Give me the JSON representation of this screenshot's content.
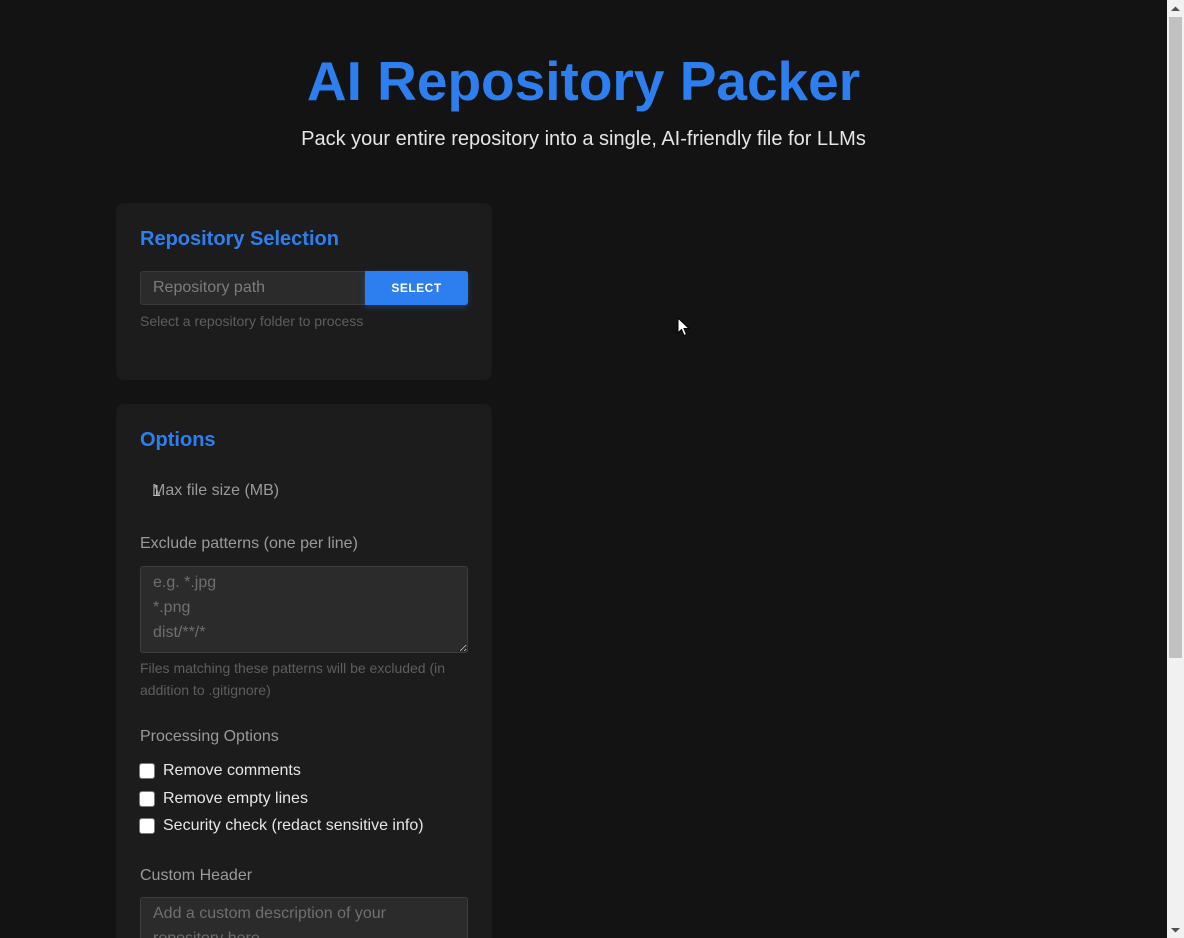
{
  "header": {
    "title": "AI Repository Packer",
    "subtitle": "Pack your entire repository into a single, AI-friendly file for LLMs"
  },
  "repository": {
    "title": "Repository Selection",
    "path_placeholder": "Repository path",
    "path_value": "",
    "select_label": "SELECT",
    "helper": "Select a repository folder to process"
  },
  "options": {
    "title": "Options",
    "max_size_value": "1",
    "max_size_label": "Max file size (MB)",
    "exclude_label": "Exclude patterns (one per line)",
    "exclude_placeholder": "e.g. *.jpg\n*.png\ndist/**/*",
    "exclude_helper": "Files matching these patterns will be excluded (in addition to .gitignore)",
    "processing_label": "Processing Options",
    "checkboxes": [
      {
        "label": "Remove comments",
        "checked": false
      },
      {
        "label": "Remove empty lines",
        "checked": false
      },
      {
        "label": "Security check (redact sensitive info)",
        "checked": false
      }
    ],
    "custom_header_label": "Custom Header",
    "custom_header_placeholder": "Add a custom description of your repository here"
  },
  "colors": {
    "accent": "#2d7ff0",
    "background": "#131313",
    "card": "#1c1c1c"
  }
}
